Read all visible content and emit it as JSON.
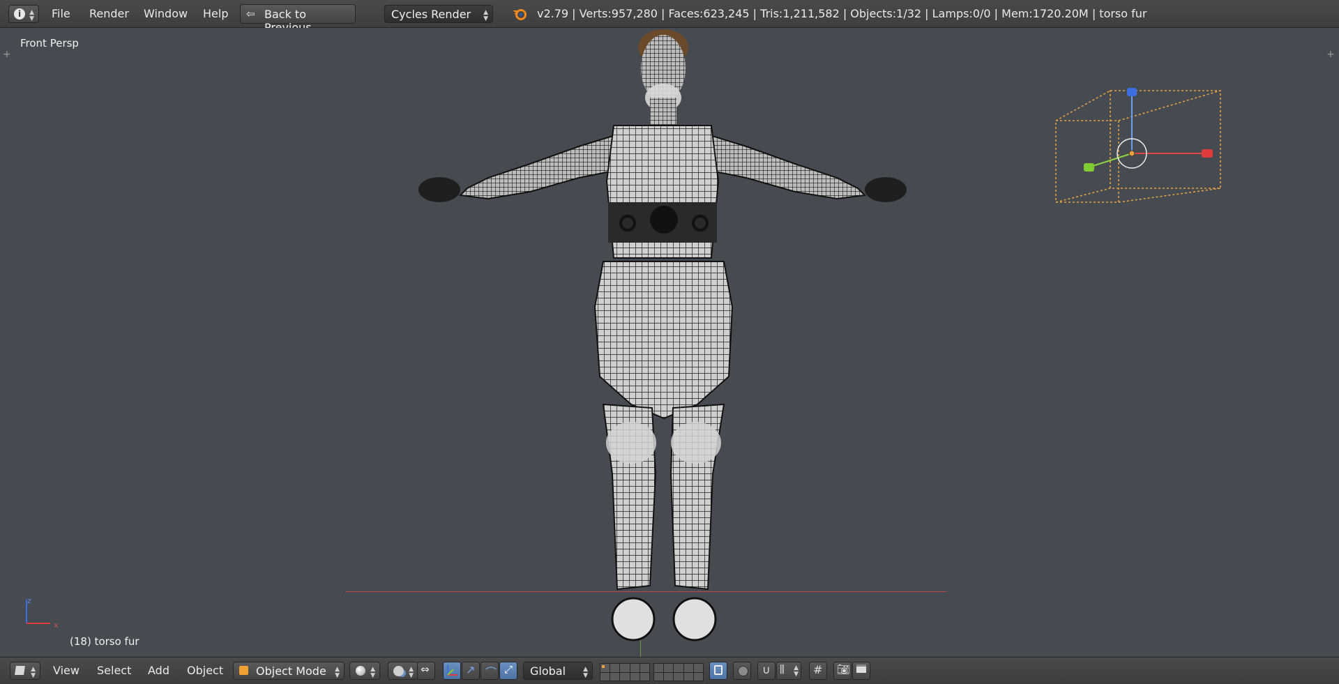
{
  "topbar": {
    "info_icon": "info-icon",
    "menus": [
      "File",
      "Render",
      "Window",
      "Help"
    ],
    "back_button": "Back to Previous",
    "engine": "Cycles Render",
    "stats": "v2.79 | Verts:957,280 | Faces:623,245 | Tris:1,211,582 | Objects:1/32 | Lamps:0/0 | Mem:1720.20M | torso fur"
  },
  "viewport": {
    "view_name": "Front Persp",
    "object_label": "(18) torso fur",
    "axis_z": "z",
    "axis_x": "x"
  },
  "bottombar": {
    "menus": [
      "View",
      "Select",
      "Add",
      "Object"
    ],
    "mode": "Object Mode",
    "orientation": "Global"
  },
  "colors": {
    "viewport_bg": "#464b52",
    "header_bg": "#3e3e3e",
    "axis_x": "#e03c3c",
    "axis_y": "#7fcc33",
    "axis_z": "#3c6ee0",
    "bounds": "#e8a040",
    "active_button": "#5680c2"
  }
}
